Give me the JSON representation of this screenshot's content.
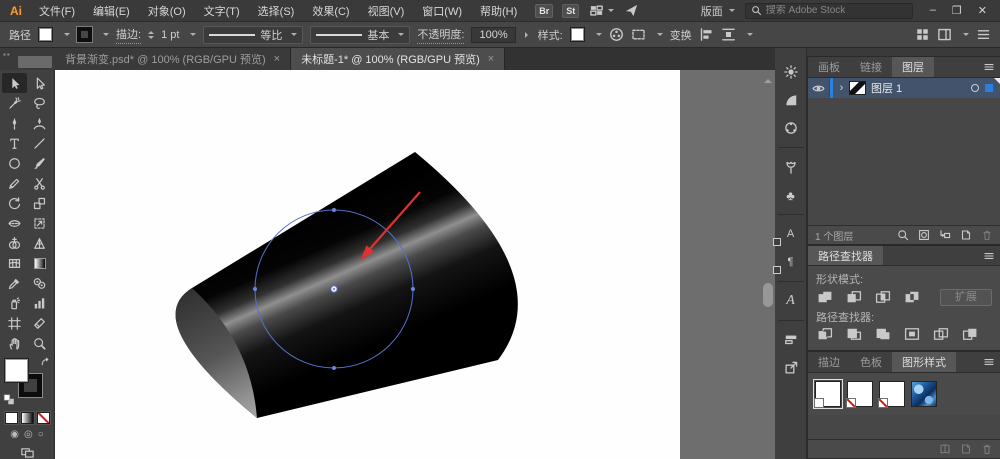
{
  "app": {
    "theme_colors": {
      "accent_blue": "#2f7fe0",
      "selection_blue": "#5671cc",
      "arrow_red": "#e03131",
      "logo_orange": "#ff9a33"
    }
  },
  "menubar": {
    "logo": "Ai",
    "items": [
      "文件(F)",
      "编辑(E)",
      "对象(O)",
      "文字(T)",
      "选择(S)",
      "效果(C)",
      "视图(V)",
      "窗口(W)",
      "帮助(H)"
    ],
    "badges": [
      "Br",
      "St"
    ],
    "workspace_label": "版面",
    "search_placeholder": "搜索 Adobe Stock",
    "window_controls": {
      "minimize": "–",
      "restore": "❐",
      "close": "✕"
    }
  },
  "optionsbar": {
    "context_label": "路径",
    "stroke_label": "描边:",
    "stroke_value": "1 pt",
    "profile_value": "等比",
    "brush_value": "基本",
    "opacity_label": "不透明度:",
    "opacity_value": "100%",
    "style_label": "样式:",
    "transform_label": "变换"
  },
  "document_tabs": [
    {
      "title": "背景渐变.psd* @ 100% (RGB/GPU 预览)",
      "close": "×"
    },
    {
      "title": "未标题-1* @ 100% (RGB/GPU 预览)",
      "close": "×"
    }
  ],
  "toolbox": {
    "active_tool": "selection",
    "tools": [
      "selection",
      "direct-selection",
      "magic-wand",
      "lasso",
      "pen",
      "curvature",
      "type",
      "line-segment",
      "shape",
      "paintbrush",
      "pencil",
      "scissors",
      "rotate",
      "scale",
      "width",
      "free-transform",
      "shape-builder",
      "perspective-grid",
      "mesh",
      "gradient",
      "eyedropper",
      "blend",
      "symbol-sprayer",
      "column-graph",
      "artboard",
      "slice",
      "hand",
      "zoom"
    ],
    "draw_modes": [
      "◉",
      "◎",
      "○"
    ]
  },
  "panels": {
    "layers": {
      "tabs": [
        "画板",
        "链接",
        "图层"
      ],
      "active_tab": "图层",
      "rows": [
        {
          "name": "图层 1",
          "visible": true,
          "selected": true,
          "expand_glyph": "›"
        }
      ],
      "status": "1 个图层"
    },
    "pathfinder": {
      "title": "路径查找器",
      "shape_modes_label": "形状模式:",
      "pathfinder_label": "路径查找器:",
      "expand_button": "扩展",
      "shape_mode_icons": [
        "unite",
        "minus-front",
        "intersect",
        "exclude"
      ],
      "pathfinder_icons": [
        "divide",
        "trim",
        "merge",
        "crop",
        "outline",
        "minus-back"
      ]
    },
    "graphic_styles": {
      "tabs": [
        "描边",
        "色板",
        "图形样式"
      ],
      "active_tab": "图形样式",
      "items": [
        "default",
        "no-fill-style",
        "no-stroke-style",
        "blue-texture"
      ]
    }
  },
  "icons": {
    "club": "♣",
    "paragraph": "¶",
    "letter_a": "A",
    "glyphs_a": "A",
    "draw_mode_1": "◉",
    "draw_mode_2": "◎",
    "draw_mode_3": "○"
  }
}
